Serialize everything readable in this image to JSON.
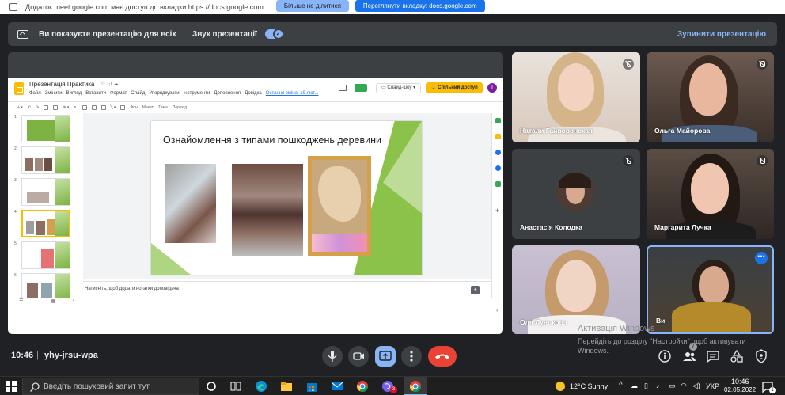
{
  "infobar": {
    "text": "Додаток meet.google.com має доступ до вкладки https://docs.google.com",
    "stop_label": "Більше не ділитися",
    "view_label": "Переглянути вкладку: docs.google.com"
  },
  "presenting": {
    "message": "Ви показуєте презентацію для всіх",
    "sound_label": "Звук презентації",
    "stop_label": "Зупинити презентацію"
  },
  "slides_app": {
    "title": "Презентація Практика",
    "menu": [
      "Файл",
      "Змінити",
      "Вигляд",
      "Вставити",
      "Формат",
      "Слайд",
      "Упорядкувати",
      "Інструменти",
      "Доповнення",
      "Довідка"
    ],
    "last_edit": "Остання зміна: 19 лют...",
    "slideshow_label": "Слайд-шоу",
    "share_label": "Спільний доступ",
    "avatar_letter": "I",
    "toolbar_items": [
      "Фон",
      "Макет",
      "Тема",
      "Перехід"
    ],
    "thumb_numbers": [
      "1",
      "2",
      "3",
      "4",
      "5",
      "6"
    ],
    "slide_title": "Ознайомлення з типами пошкоджень деревини",
    "notes_placeholder": "Натисніть, щоб додати нотатки доповідача"
  },
  "participants": [
    {
      "name": "Натали Гайворонская",
      "muted": true
    },
    {
      "name": "Ольга Майорова",
      "muted": true
    },
    {
      "name": "Анастасія Колодка",
      "muted": true
    },
    {
      "name": "Маргарита Лучка",
      "muted": true
    },
    {
      "name": "Оля Лунькова",
      "muted": false
    },
    {
      "name": "Ви",
      "muted": false
    }
  ],
  "activation": {
    "line1": "Активація Windows",
    "line2": "Перейдіть до розділу \"Настройки\", щоб активувати",
    "line3": "Windows."
  },
  "meet_bar": {
    "time": "10:46",
    "separator": "|",
    "code": "yhy-jrsu-wpa",
    "people_count": "7"
  },
  "taskbar": {
    "search_placeholder": "Введіть пошуковий запит тут",
    "weather": "12°C  Sunny",
    "lang": "УКР",
    "clock_time": "10:46",
    "clock_date": "02.05.2022",
    "notif_count": "1",
    "viber_badge": "3"
  },
  "colors": {
    "meet_bg": "#202124",
    "accent": "#8ab4f8",
    "end_call": "#ea4335",
    "share_yellow": "#fbbc04"
  }
}
